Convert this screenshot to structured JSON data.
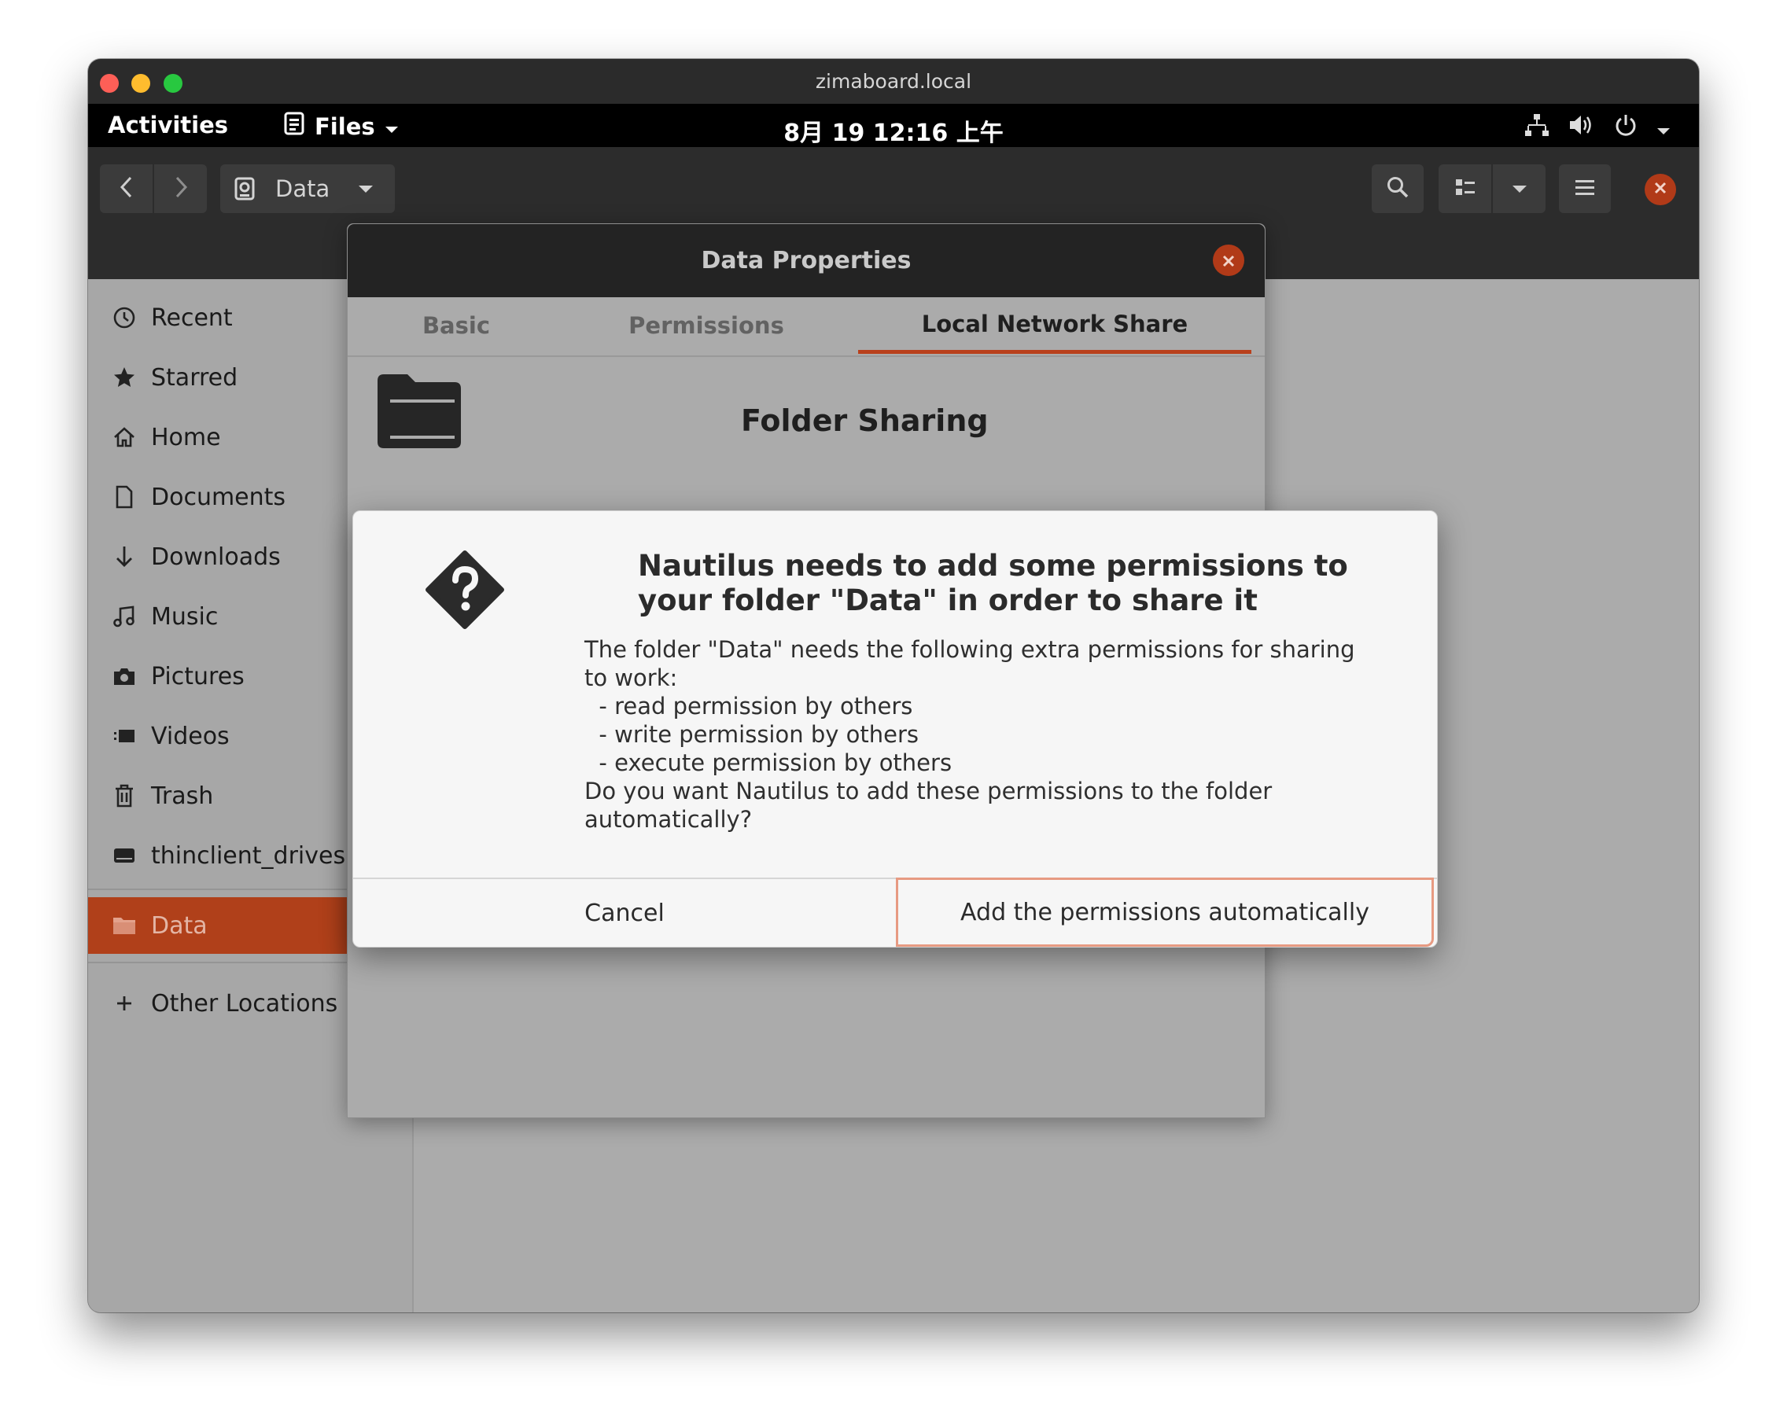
{
  "window": {
    "title": "zimaboard.local"
  },
  "topbar": {
    "activities": "Activities",
    "app_menu": "Files",
    "clock": "8月 19 12:16 上午"
  },
  "headerbar": {
    "path_label": "Data"
  },
  "sidebar": {
    "items": [
      {
        "label": "Recent",
        "icon": "clock-icon"
      },
      {
        "label": "Starred",
        "icon": "star-icon"
      },
      {
        "label": "Home",
        "icon": "home-icon"
      },
      {
        "label": "Documents",
        "icon": "document-icon"
      },
      {
        "label": "Downloads",
        "icon": "download-icon"
      },
      {
        "label": "Music",
        "icon": "music-icon"
      },
      {
        "label": "Pictures",
        "icon": "camera-icon"
      },
      {
        "label": "Videos",
        "icon": "video-icon"
      },
      {
        "label": "Trash",
        "icon": "trash-icon"
      },
      {
        "label": "thinclient_drives",
        "icon": "drive-icon"
      }
    ],
    "active_item": {
      "label": "Data",
      "icon": "folder-icon"
    },
    "other_locations": "Other Locations"
  },
  "properties": {
    "title": "Data Properties",
    "tabs": [
      "Basic",
      "Permissions",
      "Local Network Share"
    ],
    "active_tab": "Local Network Share",
    "section_title": "Folder Sharing"
  },
  "dialog": {
    "heading_line1": "Nautilus needs to add some permissions to",
    "heading_line2": "your folder \"Data\" in order to share it",
    "body_lines": [
      "The folder \"Data\" needs the following extra permissions for sharing",
      "to work:",
      "  - read permission by others",
      "  - write permission by others",
      "  - execute permission by others",
      "Do you want Nautilus to add these permissions to the folder",
      "automatically?"
    ],
    "cancel_label": "Cancel",
    "confirm_label": "Add the permissions automatically"
  },
  "colors": {
    "accent": "#b0401a",
    "close_button": "#b13a18",
    "confirm_border": "#e79a82"
  }
}
